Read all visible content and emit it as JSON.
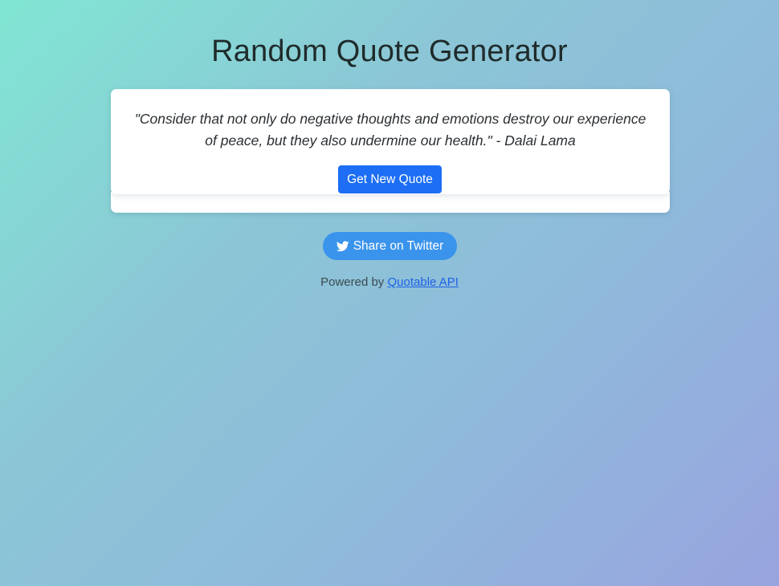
{
  "header": {
    "title": "Random Quote Generator"
  },
  "quote_card": {
    "quote_text": "\"Consider that not only do negative thoughts and emotions destroy our experience of peace, but they also undermine our health.\" - Dalai Lama",
    "new_quote_label": "Get New Quote"
  },
  "share": {
    "twitter_label": "Share on Twitter",
    "icon": "twitter-bird-icon"
  },
  "footer": {
    "prefix": "Powered by",
    "link_text": "Quotable API"
  },
  "colors": {
    "primary_button": "#1d6ef5",
    "twitter_button": "#3a94ec",
    "link": "#1f62e8",
    "background_start": "#80e6d3",
    "background_end": "#98a4df"
  }
}
